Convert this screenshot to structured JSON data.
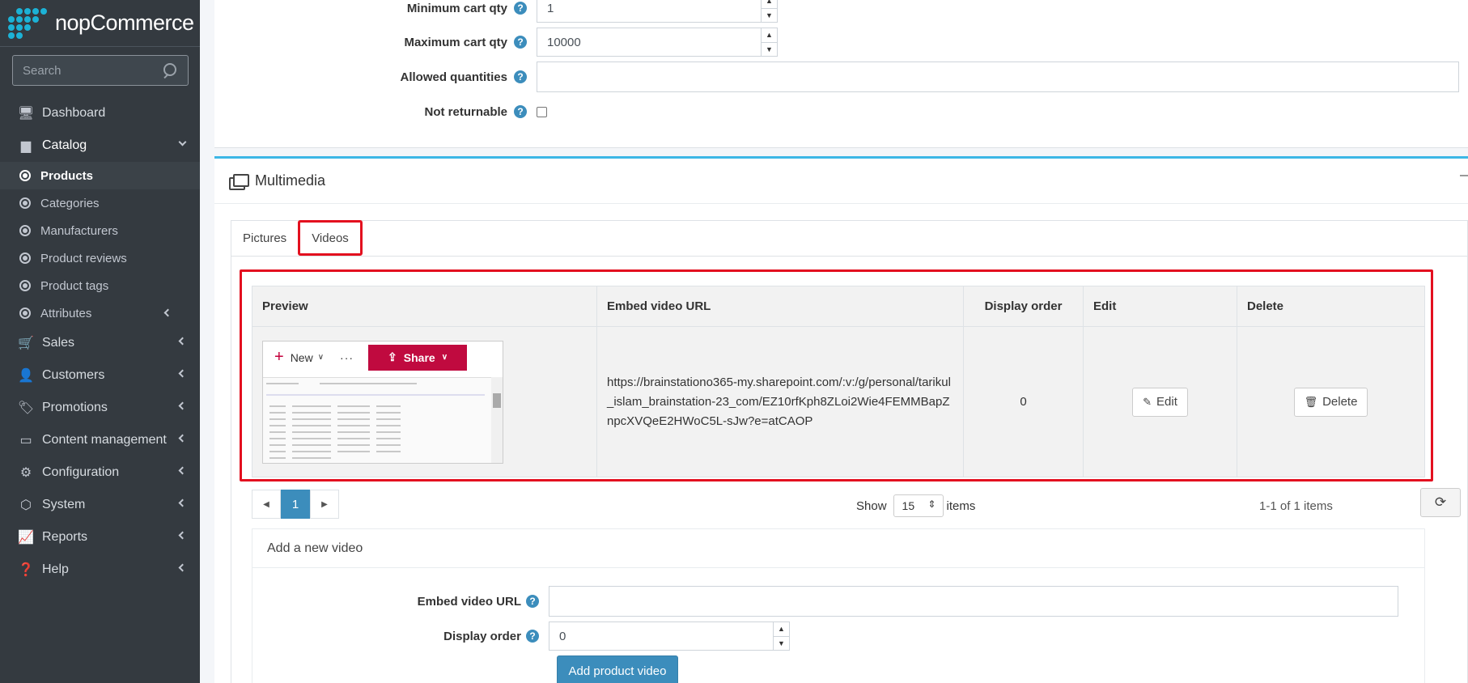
{
  "sidebar": {
    "logo_text": "nopCommerce",
    "search_placeholder": "Search",
    "items": [
      {
        "label": "Dashboard",
        "icon": "monitor-icon"
      },
      {
        "label": "Catalog",
        "icon": "book-icon"
      },
      {
        "label": "Sales",
        "icon": "cart-icon"
      },
      {
        "label": "Customers",
        "icon": "user-icon"
      },
      {
        "label": "Promotions",
        "icon": "tags-icon"
      },
      {
        "label": "Content management",
        "icon": "desktop-icon"
      },
      {
        "label": "Configuration",
        "icon": "gears-icon"
      },
      {
        "label": "System",
        "icon": "cube-icon"
      },
      {
        "label": "Reports",
        "icon": "chart-icon"
      },
      {
        "label": "Help",
        "icon": "question-icon"
      }
    ],
    "catalog_sub": [
      "Products",
      "Categories",
      "Manufacturers",
      "Product reviews",
      "Product tags",
      "Attributes"
    ]
  },
  "form": {
    "min_cart_qty_label": "Minimum cart qty",
    "min_cart_qty_value": "1",
    "max_cart_qty_label": "Maximum cart qty",
    "max_cart_qty_value": "10000",
    "allowed_quantities_label": "Allowed quantities",
    "not_returnable_label": "Not returnable"
  },
  "multimedia": {
    "title": "Multimedia",
    "tabs": [
      "Pictures",
      "Videos"
    ],
    "columns": [
      "Preview",
      "Embed video URL",
      "Display order",
      "Edit",
      "Delete"
    ],
    "row": {
      "preview_new": "New",
      "preview_share": "Share",
      "url": "https://brainstationo365-my.sharepoint.com/:v:/g/personal/tarikul_islam_brainstation-23_com/EZ10rfKph8ZLoi2Wie4FEMMBapZnpcXVQeE2HWoC5L-sJw?e=atCAOP",
      "display_order": "0",
      "edit_label": "Edit",
      "delete_label": "Delete"
    },
    "pager": {
      "current": "1"
    },
    "show_label": "Show",
    "page_size": "15",
    "items_label": "items",
    "items_count": "1-1 of 1 items"
  },
  "add_video": {
    "title": "Add a new video",
    "url_label": "Embed video URL",
    "url_value": "",
    "order_label": "Display order",
    "order_value": "0",
    "button": "Add product video"
  },
  "colors": {
    "accent": "#3c8dbc",
    "highlight": "#e3101f",
    "sidebar": "#343a40"
  }
}
